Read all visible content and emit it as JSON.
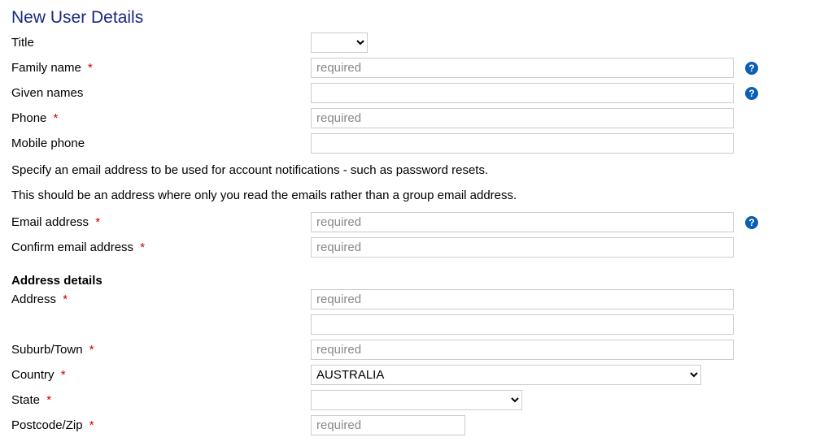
{
  "heading": "New User Details",
  "labels": {
    "title": "Title",
    "family_name": "Family name",
    "given_names": "Given names",
    "phone": "Phone",
    "mobile_phone": "Mobile phone",
    "email": "Email address",
    "confirm_email": "Confirm email address",
    "address_details": "Address details",
    "address": "Address",
    "suburb": "Suburb/Town",
    "country": "Country",
    "state": "State",
    "postcode": "Postcode/Zip"
  },
  "placeholders": {
    "required": "required"
  },
  "values": {
    "title": "",
    "family_name": "",
    "given_names": "",
    "phone": "",
    "mobile_phone": "",
    "email": "",
    "confirm_email": "",
    "address1": "",
    "address2": "",
    "suburb": "",
    "country": "AUSTRALIA",
    "state": "",
    "postcode": ""
  },
  "info": {
    "line1": "Specify an email address to be used for account notifications - such as password resets.",
    "line2": "This should be an address where only you read the emails rather than a group email address."
  },
  "required_marker": "*",
  "help_icon": "?"
}
